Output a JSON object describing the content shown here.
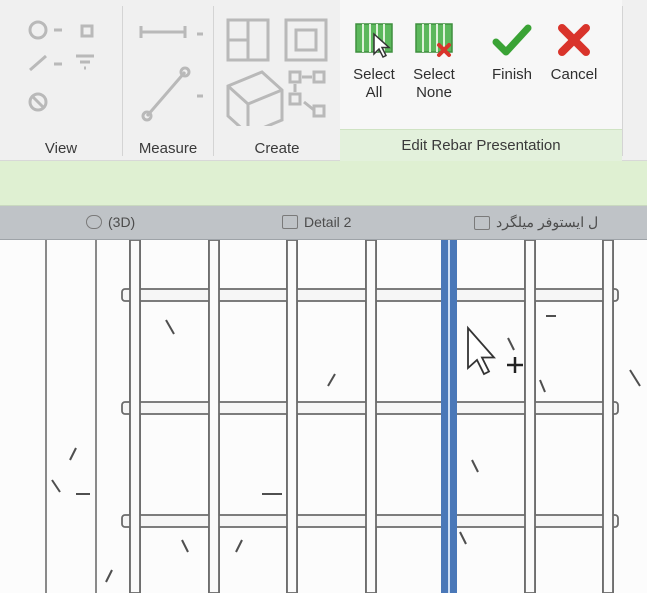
{
  "ribbon": {
    "panels": {
      "view": "View",
      "measure": "Measure",
      "create": "Create",
      "edit_rebar_presentation": "Edit Rebar Presentation"
    },
    "buttons": {
      "select_all": {
        "line1": "Select",
        "line2": "All"
      },
      "select_none": {
        "line1": "Select",
        "line2": "None"
      },
      "finish": "Finish",
      "cancel": "Cancel"
    }
  },
  "view_tabs": [
    {
      "label": "(3D)",
      "icon": "3d-view-icon"
    },
    {
      "label": "Detail 2",
      "icon": "detail-view-icon"
    },
    {
      "label": "ل ایستوفر میلگرد",
      "icon": "section-view-icon"
    }
  ],
  "colors": {
    "active_rebar": "#4a78b8",
    "rebar_outline": "#6b6b6b",
    "context_tab_green": "#dff0d2",
    "finish_check": "#3aa335",
    "cancel_x": "#d9342b",
    "rebar_icon_green": "#5cb85c"
  }
}
